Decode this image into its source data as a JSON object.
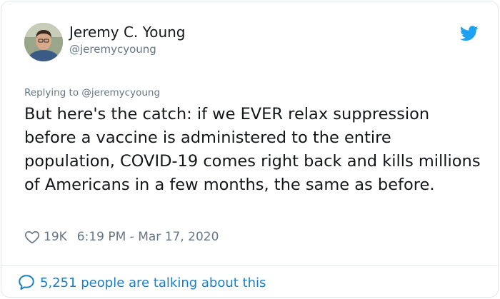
{
  "tweet": {
    "author_name": "Jeremy C. Young",
    "author_handle": "@jeremycyoung",
    "replying_prefix": "Replying to",
    "replying_to": "@jeremycyoung",
    "text": "But here's the catch: if we EVER relax suppression before a vaccine is administered to the entire population, COVID-19 comes right back and kills millions of Americans in a few months, the same as before.",
    "likes": "19K",
    "timestamp": "6:19 PM - Mar 17, 2020",
    "talking": "5,251 people are talking about this"
  },
  "icons": {
    "brand": "twitter-bird-icon",
    "like": "heart-icon",
    "reply": "speech-bubble-icon"
  },
  "colors": {
    "brand_blue": "#1da1f2",
    "link_blue": "#1b7ec2",
    "muted_gray": "#657786",
    "text": "#14171a"
  }
}
